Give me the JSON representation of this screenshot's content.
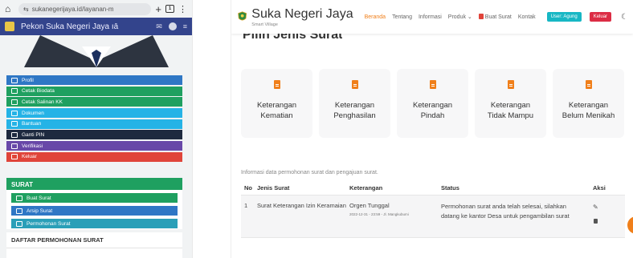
{
  "mobile": {
    "url": "sukanegerijaya.id/layanan-m",
    "site_title": "Pekon Suka Negeri Jaya ıā",
    "menu": [
      {
        "label": "Profil",
        "color": "blue",
        "icon": "user-icon"
      },
      {
        "label": "Cetak Biodata",
        "color": "green",
        "icon": "printer-icon"
      },
      {
        "label": "Cetak Salinan KK",
        "color": "green",
        "icon": "printer-icon"
      },
      {
        "label": "Dokumen",
        "color": "cyan",
        "icon": "folder-icon"
      },
      {
        "label": "Bantuan",
        "color": "cyan",
        "icon": "hand-icon"
      },
      {
        "label": "Ganti PIN",
        "color": "navy",
        "icon": "key-icon"
      },
      {
        "label": "Verifikasi",
        "color": "purple",
        "icon": "key-icon"
      },
      {
        "label": "Keluar",
        "color": "red",
        "icon": "logout-icon"
      }
    ],
    "surat": {
      "header": "SURAT",
      "items": [
        {
          "label": "Buat Surat",
          "color": "green"
        },
        {
          "label": "Arsip Surat",
          "color": "blue"
        },
        {
          "label": "Permohonan Surat",
          "color": "teal"
        }
      ]
    },
    "daftar": {
      "title": "DAFTAR PERMOHONAN SURAT"
    }
  },
  "desktop": {
    "brand": {
      "name": "Suka Negeri Jaya",
      "tagline": "Smart Village"
    },
    "nav": [
      {
        "label": "Beranda",
        "active": true
      },
      {
        "label": "Tentang",
        "active": false
      },
      {
        "label": "Informasi",
        "active": false
      },
      {
        "label": "Produk ⌄",
        "active": false
      },
      {
        "label": "Buat Surat",
        "active": false
      },
      {
        "label": "Kontak",
        "active": false
      }
    ],
    "user_button": "User: Agung",
    "logout_button": "Keluar",
    "heading": "Pilih Jenis Surat",
    "cards": [
      {
        "line1": "Keterangan",
        "line2": "Kematian"
      },
      {
        "line1": "Keterangan",
        "line2": "Penghasilan"
      },
      {
        "line1": "Keterangan",
        "line2": "Pindah"
      },
      {
        "line1": "Keterangan",
        "line2": "Tidak Mampu"
      },
      {
        "line1": "Keterangan",
        "line2": "Belum Menikah"
      }
    ],
    "info_text": "Informasi data permohonan surat dan pengajuan surat.",
    "table": {
      "headers": [
        "No",
        "Jenis Surat",
        "Keterangan",
        "Status",
        "Aksi"
      ],
      "rows": [
        {
          "no": "1",
          "jenis": "Surat Keterangan Izin Keramaian",
          "keterangan": "Orgen Tunggal",
          "keterangan_detail": "2022-12-31 - 23:59 - Jl. Mangkubumi",
          "status": "Permohonan surat anda telah selesai, silahkan datang ke kantor Desa untuk pengambilan surat"
        }
      ]
    },
    "colors": {
      "accent": "#f07f1a",
      "user_button": "#17b7c4",
      "logout_button": "#dc2d45"
    }
  }
}
